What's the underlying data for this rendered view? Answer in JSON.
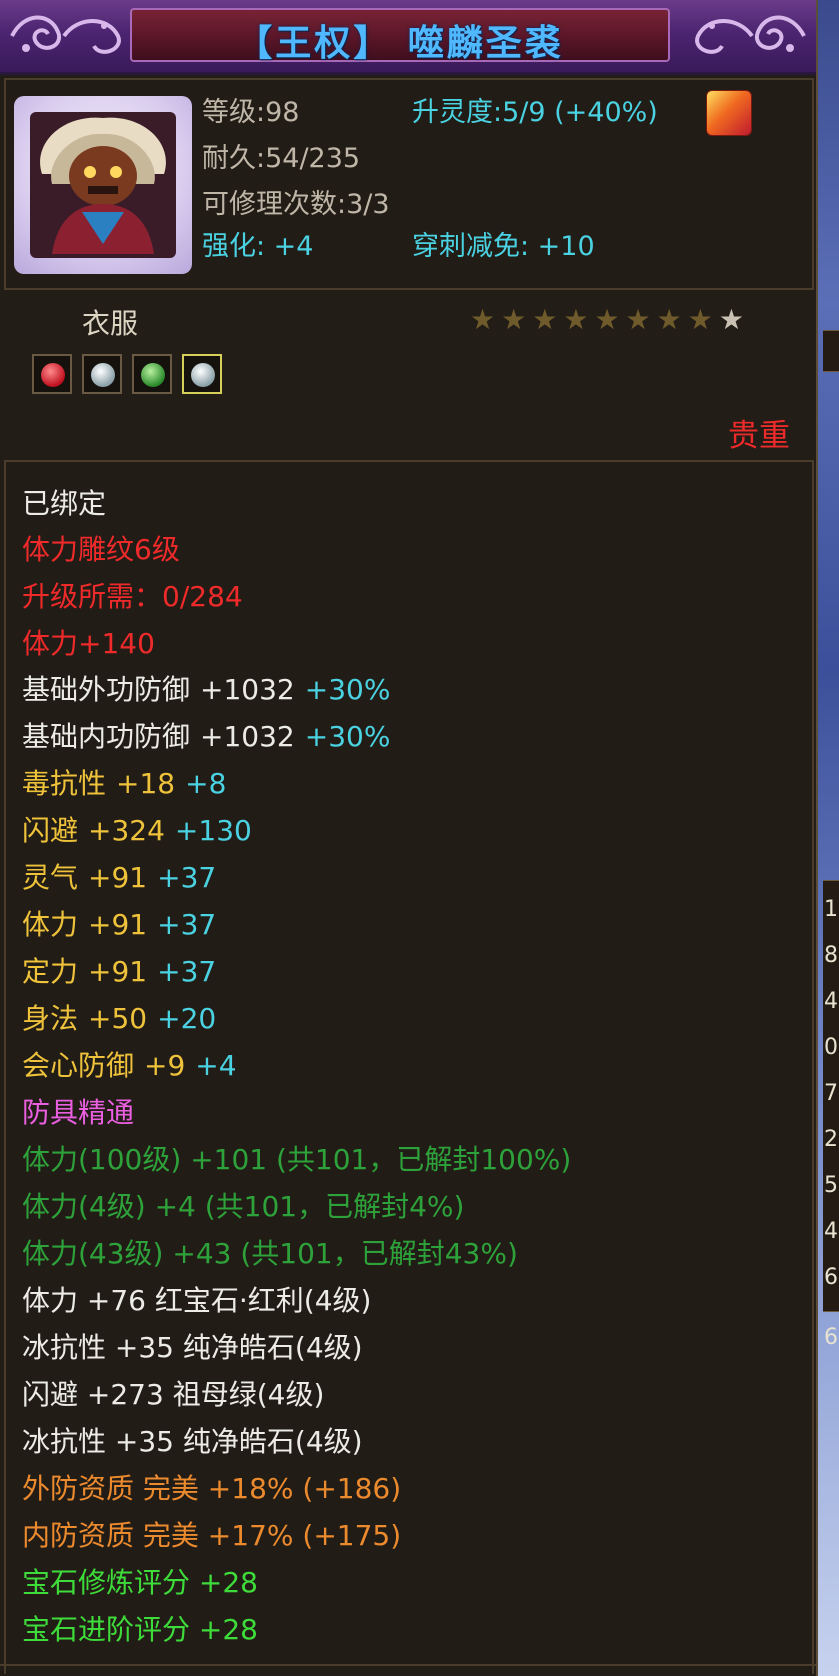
{
  "item": {
    "title": "【王权】 噬麟圣裘",
    "level": "等级:98",
    "spirit": "升灵度:5/9 (+40%)",
    "durability": "耐久:54/235",
    "repair": "可修理次数:3/3",
    "enhance": "强化: +4",
    "pierce": "穿刺减免: +10",
    "type": "衣服",
    "stars_total": 9,
    "stars_lit": 1,
    "precious": "贵重"
  },
  "attributes": [
    {
      "label": "已绑定",
      "color": "white"
    },
    {
      "label": "体力雕纹6级",
      "color": "red"
    },
    {
      "label": "升级所需：0/284",
      "color": "red"
    },
    {
      "label": "体力+140",
      "color": "red"
    },
    {
      "label": "基础外功防御",
      "value": "+1032",
      "bonus": "+30%",
      "color": "white"
    },
    {
      "label": "基础内功防御",
      "value": "+1032",
      "bonus": "+30%",
      "color": "white"
    },
    {
      "label": "毒抗性",
      "value": "+18",
      "bonus": "+8",
      "color": "yellow"
    },
    {
      "label": "闪避",
      "value": "+324",
      "bonus": "+130",
      "color": "yellow"
    },
    {
      "label": "灵气",
      "value": "+91",
      "bonus": "+37",
      "color": "yellow"
    },
    {
      "label": "体力",
      "value": "+91",
      "bonus": "+37",
      "color": "yellow"
    },
    {
      "label": "定力",
      "value": "+91",
      "bonus": "+37",
      "color": "yellow"
    },
    {
      "label": "身法",
      "value": "+50",
      "bonus": "+20",
      "color": "yellow"
    },
    {
      "label": "会心防御",
      "value": "+9",
      "bonus": "+4",
      "color": "yellow"
    },
    {
      "label": "防具精通",
      "color": "pink"
    },
    {
      "label": "体力(100级) +101 (共101，已解封100%)",
      "color": "green"
    },
    {
      "label": "体力(4级) +4 (共101，已解封4%)",
      "color": "green"
    },
    {
      "label": "体力(43级) +43 (共101，已解封43%)",
      "color": "green"
    },
    {
      "label": "体力 +76 红宝石·红利(4级)",
      "color": "white"
    },
    {
      "label": "冰抗性 +35 纯净皓石(4级)",
      "color": "white"
    },
    {
      "label": "闪避 +273 祖母绿(4级)",
      "color": "white"
    },
    {
      "label": "冰抗性 +35 纯净皓石(4级)",
      "color": "white"
    },
    {
      "label": "外防资质  完美 +18% (+186)",
      "color": "orange"
    },
    {
      "label": "内防资质  完美 +17% (+175)",
      "color": "orange"
    },
    {
      "label": "宝石修炼评分 +28",
      "color": "bgreen"
    },
    {
      "label": "宝石进阶评分 +28",
      "color": "bgreen"
    }
  ],
  "backdrop_digits": [
    "1",
    "8",
    "4",
    "0",
    "7",
    "2",
    "5",
    "4",
    "6",
    "6"
  ],
  "colors": {
    "title": "#4fb8ff",
    "cyan": "#4ad2e2",
    "red": "#ee2a2a",
    "yellow": "#eec23a",
    "green": "#2ea23a",
    "orange": "#ec8a2e"
  }
}
